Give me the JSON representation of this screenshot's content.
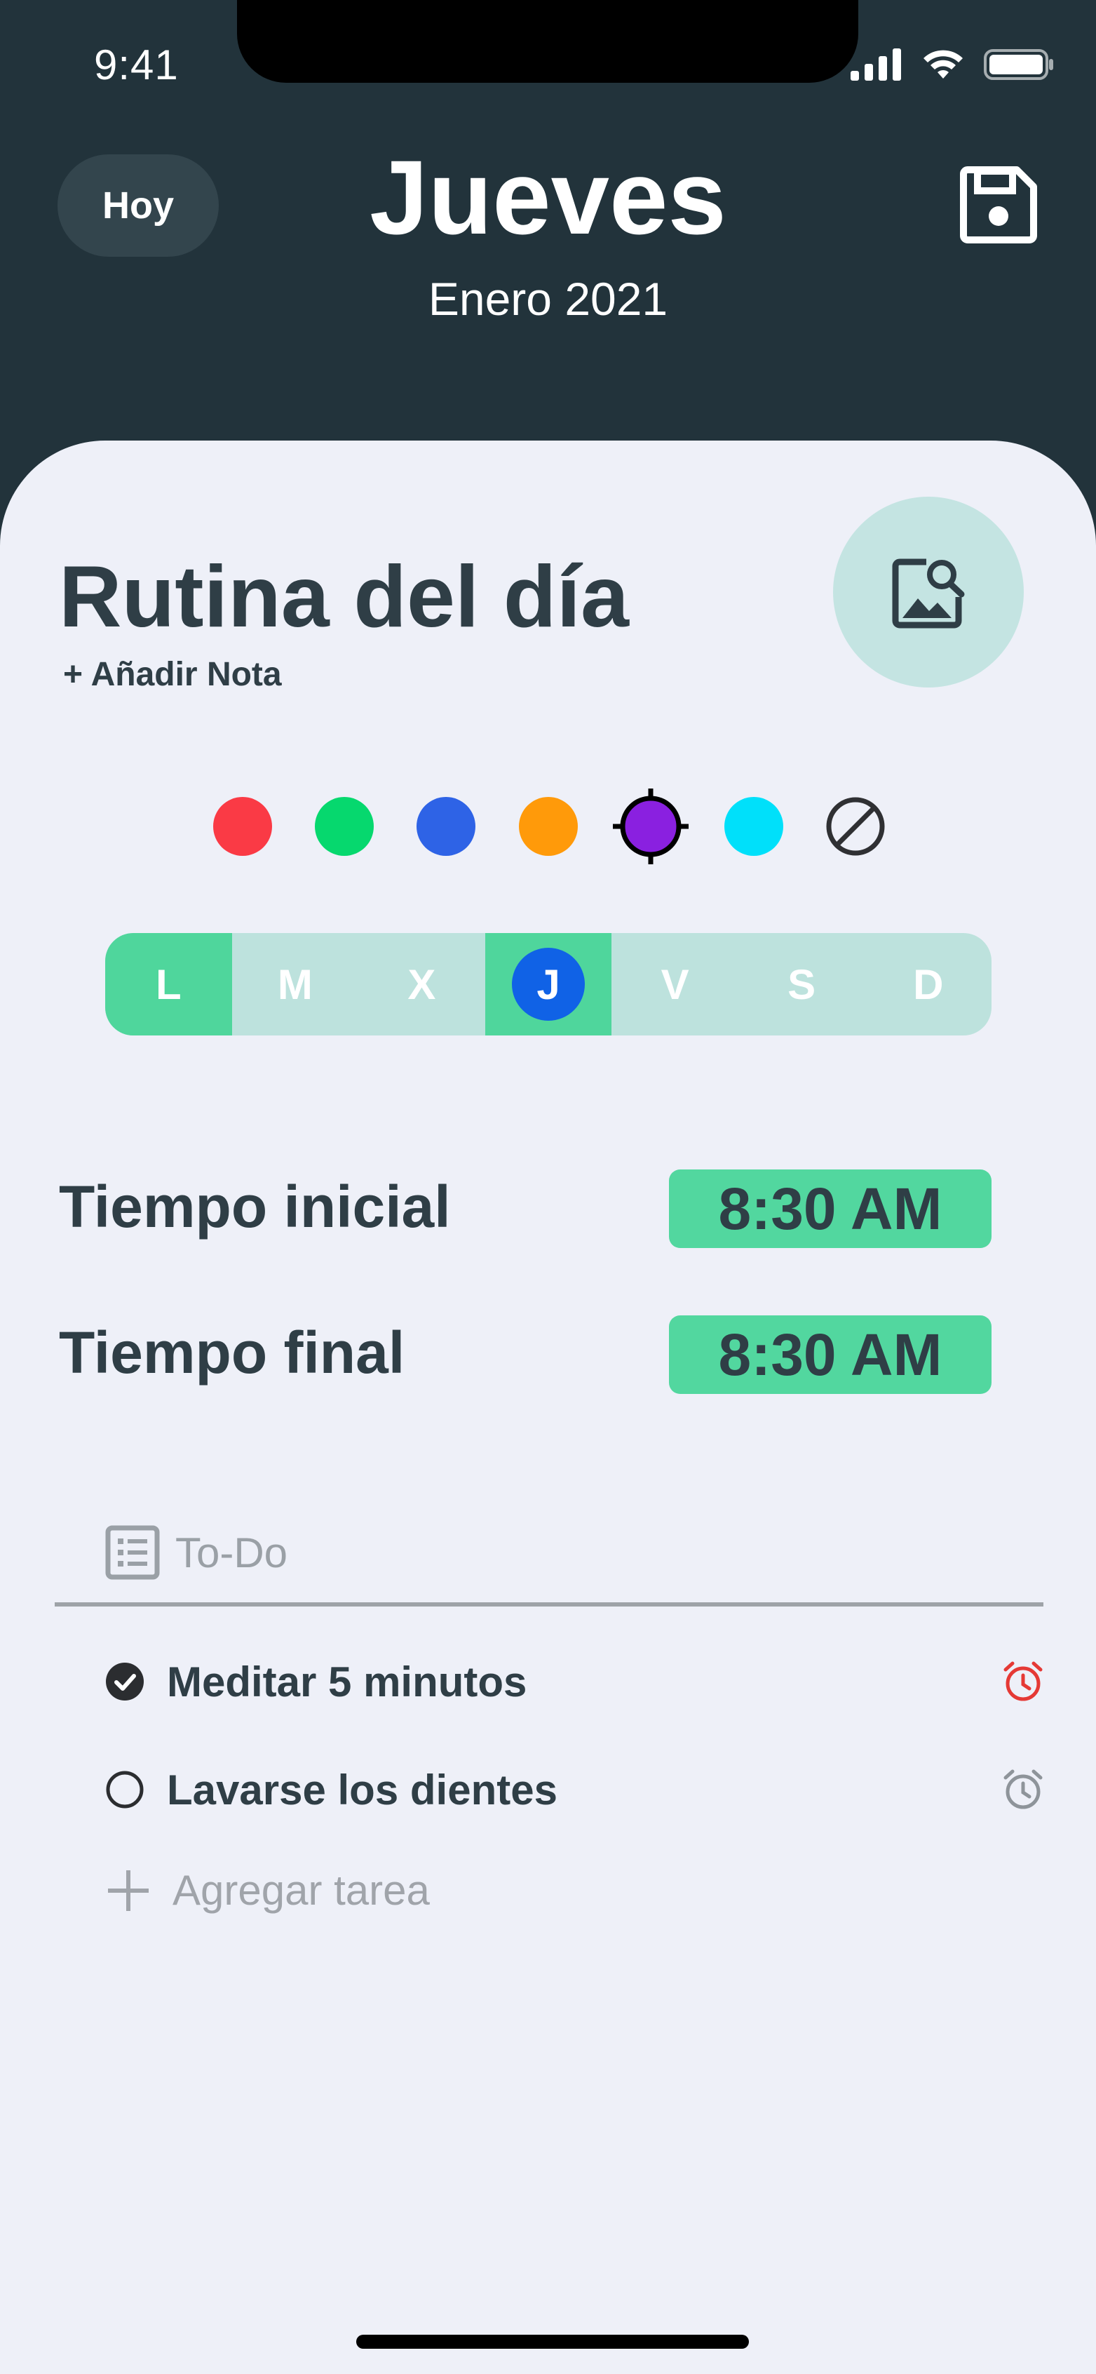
{
  "status_bar": {
    "time": "9:41"
  },
  "header": {
    "today_label": "Hoy",
    "title": "Jueves",
    "subtitle": "Enero 2021"
  },
  "routine": {
    "title": "Rutina del día",
    "add_note": "+ Añadir Nota"
  },
  "colors": {
    "options": [
      "#fa3a45",
      "#06d86e",
      "#2e63e6",
      "#ff9a0a",
      "#8a20e0",
      "#00e0fa",
      "none"
    ],
    "selected": "#8a20e0"
  },
  "days": {
    "items": [
      {
        "label": "L",
        "active": true
      },
      {
        "label": "M",
        "active": false
      },
      {
        "label": "X",
        "active": false
      },
      {
        "label": "J",
        "active": true,
        "today": true
      },
      {
        "label": "V",
        "active": false
      },
      {
        "label": "S",
        "active": false
      },
      {
        "label": "D",
        "active": false
      }
    ]
  },
  "times": {
    "start_label": "Tiempo inicial",
    "start_value": "8:30 AM",
    "end_label": "Tiempo final",
    "end_value": "8:30 AM"
  },
  "todo": {
    "placeholder": "To-Do",
    "tasks": [
      {
        "label": "Meditar 5 minutos",
        "done": true,
        "alarm_color": "#e53935"
      },
      {
        "label": "Lavarse los dientes",
        "done": false,
        "alarm_color": "#8e949a"
      }
    ],
    "add_task_label": "Agregar tarea"
  },
  "icons": {
    "save": "save-icon",
    "image_search": "image-search-icon",
    "list": "list-icon",
    "alarm": "alarm-icon",
    "plus": "plus-icon",
    "no_color": "no-color-icon"
  }
}
